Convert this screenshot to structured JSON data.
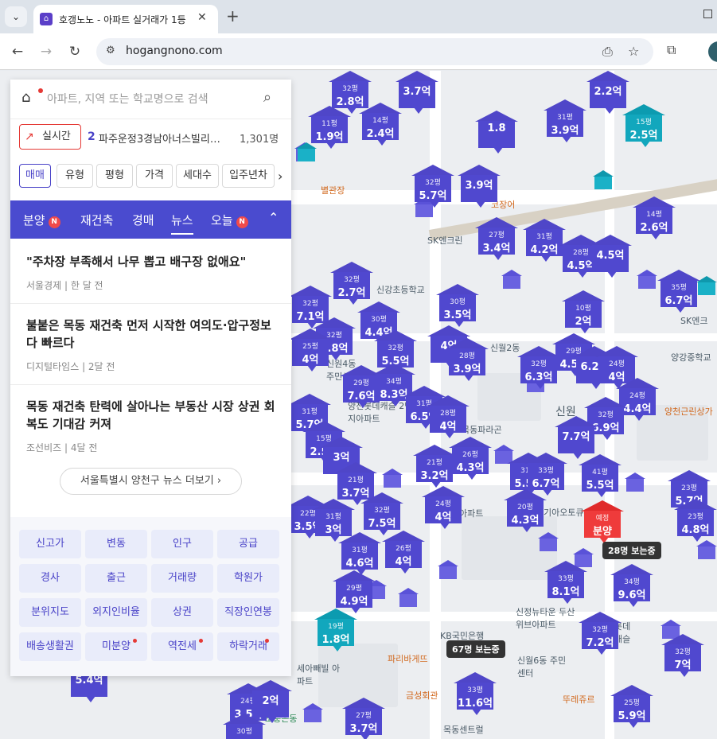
{
  "browser": {
    "tab_title": "호갱노노 - 아파트 실거래가 1등",
    "tab_favicon": "home-icon",
    "url": "hogangnono.com",
    "tab_menu_label": "⌄",
    "new_tab_label": "+",
    "close_tab_label": "✕"
  },
  "search": {
    "placeholder": "아파트, 지역 또는 학교명으로 검색"
  },
  "realtime": {
    "button_label": "실시간",
    "rank": "2",
    "name": "파주운정3경남아너스빌리…",
    "count": "1,301명"
  },
  "filters": [
    {
      "label": "매매",
      "active": true
    },
    {
      "label": "유형",
      "active": false
    },
    {
      "label": "평형",
      "active": false
    },
    {
      "label": "가격",
      "active": false
    },
    {
      "label": "세대수",
      "active": false
    },
    {
      "label": "입주년차",
      "active": false
    }
  ],
  "news_tabs": [
    {
      "label": "분양",
      "badge": "N"
    },
    {
      "label": "재건축",
      "badge": ""
    },
    {
      "label": "경매",
      "badge": ""
    },
    {
      "label": "뉴스",
      "badge": "",
      "active": true
    },
    {
      "label": "오늘",
      "badge": "N"
    }
  ],
  "news": [
    {
      "title": "\"주차장 부족해서 나무 뽑고 배구장 없애요\"",
      "source": "서울경제",
      "time": "한 달 전"
    },
    {
      "title": "불붙은 목동 재건축 먼저 시작한 여의도·압구정보다 빠르다",
      "source": "디지털타임스",
      "time": "2달 전"
    },
    {
      "title": "목동 재건축 탄력에 살아나는 부동산 시장 상권 회복도 기대감 커져",
      "source": "조선비즈",
      "time": "4달 전"
    }
  ],
  "more_news_label": "서울특별시 양천구 뉴스 더보기",
  "info_buttons": [
    {
      "label": "신고가",
      "dot": false
    },
    {
      "label": "변동",
      "dot": false
    },
    {
      "label": "인구",
      "dot": false
    },
    {
      "label": "공급",
      "dot": false
    },
    {
      "label": "경사",
      "dot": false
    },
    {
      "label": "출근",
      "dot": false
    },
    {
      "label": "거래량",
      "dot": false
    },
    {
      "label": "학원가",
      "dot": false
    },
    {
      "label": "분위지도",
      "dot": false
    },
    {
      "label": "외지인비율",
      "dot": false
    },
    {
      "label": "상권",
      "dot": false
    },
    {
      "label": "직장인연봉",
      "dot": false
    },
    {
      "label": "배송생활권",
      "dot": false
    },
    {
      "label": "미분양",
      "dot": true
    },
    {
      "label": "역전세",
      "dot": true
    },
    {
      "label": "하락거래",
      "dot": true
    }
  ],
  "map_markers": [
    {
      "size": "32평",
      "price": "2.8억"
    },
    {
      "size": "",
      "price": "3.7억"
    },
    {
      "size": "",
      "price": "2.2억"
    },
    {
      "size": "11평",
      "price": "1.9억"
    },
    {
      "size": "14평",
      "price": "2.4억"
    },
    {
      "size": "",
      "price": "1.8"
    },
    {
      "size": "31평",
      "price": "3.9억"
    },
    {
      "size": "15평",
      "price": "2.5억"
    },
    {
      "size": "32평",
      "price": "5.7억"
    },
    {
      "size": "",
      "price": "3.9억"
    },
    {
      "size": "14평",
      "price": "2.6억"
    },
    {
      "size": "27평",
      "price": "3.4억"
    },
    {
      "size": "31평",
      "price": "4.2억"
    },
    {
      "size": "28평",
      "price": "4.5억"
    },
    {
      "size": "",
      "price": "4.5억"
    },
    {
      "size": "32평",
      "price": "2.7억"
    },
    {
      "size": "35평",
      "price": "6.7억"
    },
    {
      "size": "32평",
      "price": "7.1억"
    },
    {
      "size": "30평",
      "price": "3.5억"
    },
    {
      "size": "30평",
      "price": "4.4억"
    },
    {
      "size": "10평",
      "price": "2억"
    },
    {
      "size": "32평",
      "price": "5.8억"
    },
    {
      "size": "32평",
      "price": "5.5억"
    },
    {
      "size": "",
      "price": "4억"
    },
    {
      "size": "25평",
      "price": "4억"
    },
    {
      "size": "28평",
      "price": "3.9억"
    },
    {
      "size": "32평",
      "price": "6.3억"
    },
    {
      "size": "29평",
      "price": "4.5억"
    },
    {
      "size": "",
      "price": "6.2억"
    },
    {
      "size": "24평",
      "price": "4억"
    },
    {
      "size": "29평",
      "price": "7.6억"
    },
    {
      "size": "34평",
      "price": "8.3억"
    },
    {
      "size": "31평",
      "price": "6.5억"
    },
    {
      "size": "28평",
      "price": "4억"
    },
    {
      "size": "24평",
      "price": "4.4억"
    },
    {
      "size": "31평",
      "price": "5.7억"
    },
    {
      "size": "32평",
      "price": "6.9억"
    },
    {
      "size": "",
      "price": "7.7억"
    },
    {
      "size": "15평",
      "price": "2.5억"
    },
    {
      "size": "",
      "price": "3억"
    },
    {
      "size": "21평",
      "price": "3.2억"
    },
    {
      "size": "26평",
      "price": "4.3억"
    },
    {
      "size": "31평",
      "price": "5.5억"
    },
    {
      "size": "33평",
      "price": "6.7억"
    },
    {
      "size": "41평",
      "price": "5.5억"
    },
    {
      "size": "21평",
      "price": "3.7억"
    },
    {
      "size": "32평",
      "price": "7.5억"
    },
    {
      "size": "22평",
      "price": "3.5억"
    },
    {
      "size": "31평",
      "price": "3억"
    },
    {
      "size": "24평",
      "price": "4억"
    },
    {
      "size": "20평",
      "price": "4.3억"
    },
    {
      "size": "23평",
      "price": "5.7억"
    },
    {
      "size": "23평",
      "price": "4.8억"
    },
    {
      "size": "31평",
      "price": "4.6억"
    },
    {
      "size": "26평",
      "price": "4억"
    },
    {
      "size": "33평",
      "price": "8.1억"
    },
    {
      "size": "34평",
      "price": "9.6억"
    },
    {
      "size": "29평",
      "price": "4.9억"
    },
    {
      "size": "19평",
      "price": "1.8억"
    },
    {
      "size": "32평",
      "price": "7.2억"
    },
    {
      "size": "32평",
      "price": "7억"
    },
    {
      "size": "33평",
      "price": "11.6억"
    },
    {
      "size": "24평",
      "price": "3.5억"
    },
    {
      "size": "",
      "price": "2억"
    },
    {
      "size": "27평",
      "price": "3.7억"
    },
    {
      "size": "25평",
      "price": "5.9억"
    },
    {
      "size": "30평",
      "price": "4.5억"
    },
    {
      "size": "",
      "price": "5.4억"
    }
  ],
  "presale_marker": {
    "size": "예정",
    "price": "분양"
  },
  "viewers": [
    {
      "label": "28명 보는중"
    },
    {
      "label": "67명 보는중"
    }
  ],
  "map_labels": [
    "별관장",
    "코장어",
    "SK엔크린",
    "신강초등학교",
    "양강중학교",
    "신원",
    "양천근린상가",
    "양천롯데캐슬 2단지아파트",
    "목동파라곤",
    "신원4동 주민센터",
    "신월2동",
    "SK엔크",
    "기아오토큐",
    "신정뉴타운 두산위브아파트",
    "KB국민은행",
    "파리바게뜨",
    "신월6동 주민센터",
    "금성회관",
    "목동센트럴",
    "뚜레쥬르",
    "세아빼빌 아파트",
    "롯데캐슬",
    "아파트",
    "소풍은동"
  ],
  "colors": {
    "marker": "#5048cf",
    "marker_teal": "#12a7bd",
    "presale": "#ef3b3b",
    "accent": "#4a4bcf",
    "badge": "#f14a4a"
  }
}
